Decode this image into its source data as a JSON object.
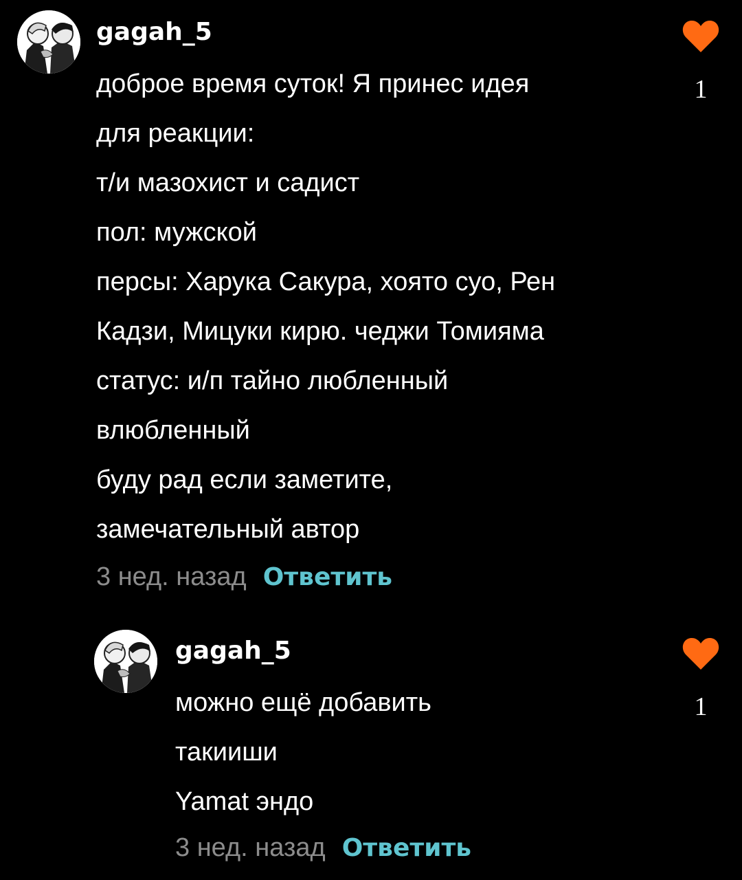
{
  "colors": {
    "background": "#000000",
    "text": "#ffffff",
    "timestamp": "#8c8c8c",
    "reply": "#5fc4cf",
    "like": "#ff6a13"
  },
  "comments": [
    {
      "username": "gagah_5",
      "avatar_icon": "user-avatar-icon",
      "lines": [
        "доброе время суток! Я принес идея",
        "для реакции:",
        "т/и мазохист и садист",
        "пол: мужской",
        "персы: Харука Сакура, хоято суо, Рен",
        "Кадзи, Мицуки кирю. чеджи Томияма",
        "статус: и/п тайно любленный",
        "влюбленный",
        "буду рад если заметите,",
        "замечательный автор"
      ],
      "timestamp": "3 нед. назад",
      "reply_label": "Ответить",
      "like_icon": "heart-icon",
      "like_count": "1"
    },
    {
      "username": "gagah_5",
      "avatar_icon": "user-avatar-icon",
      "lines": [
        "можно ещё добавить",
        "такииши",
        "Yamat эндо"
      ],
      "timestamp": "3 нед. назад",
      "reply_label": "Ответить",
      "like_icon": "heart-icon",
      "like_count": "1"
    }
  ]
}
